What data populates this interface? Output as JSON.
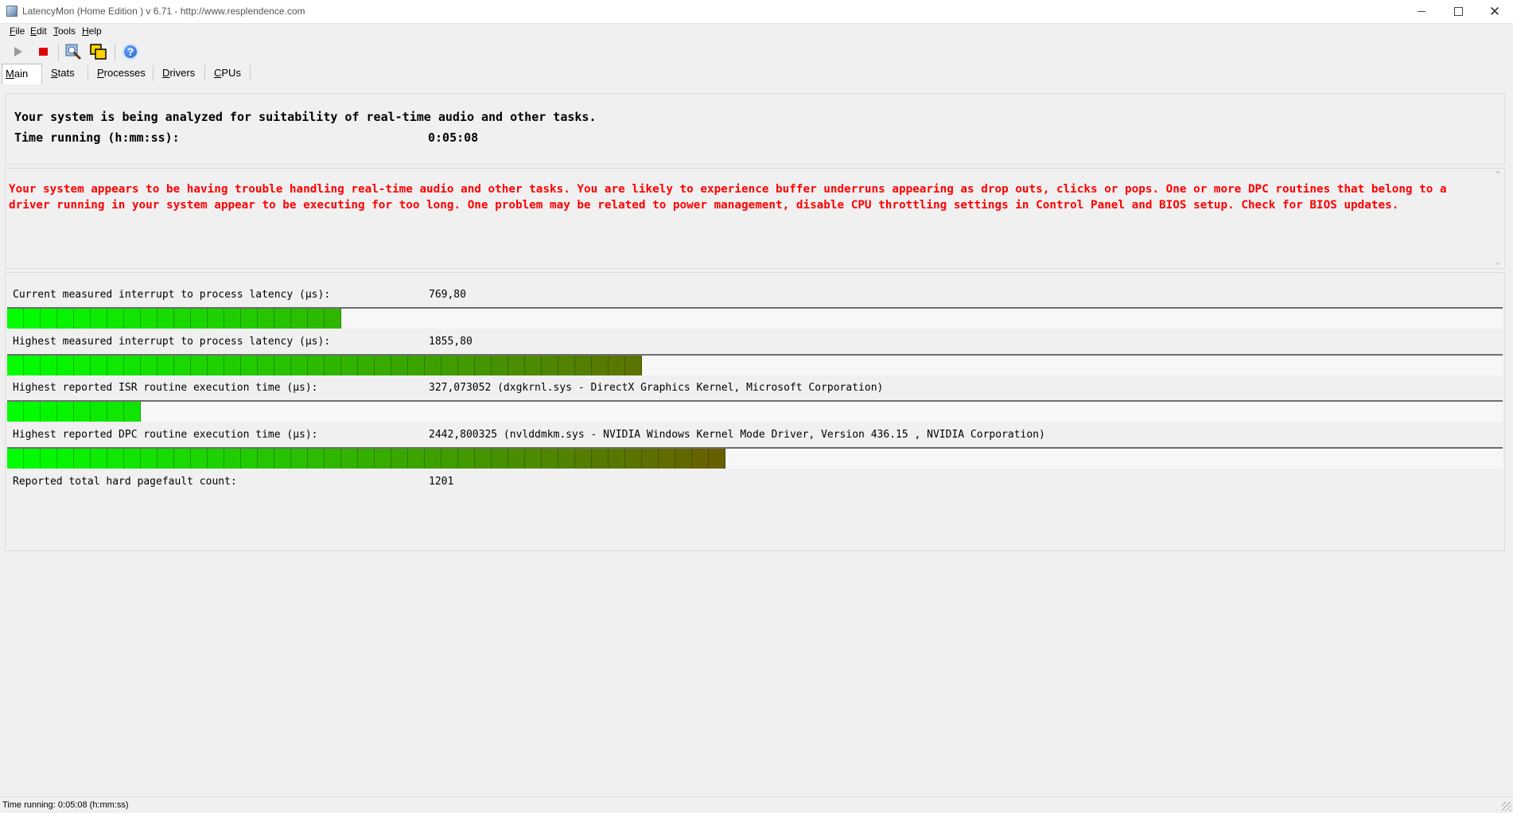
{
  "window": {
    "title": "LatencyMon  (Home Edition )  v 6.71 - http://www.resplendence.com",
    "minimize_glyph": "",
    "close_glyph": "✕"
  },
  "menu": [
    "File",
    "Edit",
    "Tools",
    "Help"
  ],
  "toolbar": {
    "icons": [
      "play-icon",
      "stop-icon",
      "system-info-icon",
      "windows-icon",
      "help-icon"
    ],
    "help_glyph": "?"
  },
  "tabs": [
    {
      "label": "Main",
      "active": true
    },
    {
      "label": "Stats",
      "active": false
    },
    {
      "label": "Processes",
      "active": false
    },
    {
      "label": "Drivers",
      "active": false
    },
    {
      "label": "CPUs",
      "active": false
    }
  ],
  "analysis": {
    "line1": "Your system is being analyzed for suitability of real-time audio and other tasks.",
    "time_label": "Time running (h:mm:ss):",
    "time_value": "0:05:08"
  },
  "warning": {
    "text": "Your system appears to be having trouble handling real-time audio and other tasks. You are likely to experience buffer underruns appearing as drop outs, clicks or pops. One or more DPC routines that belong to a driver running in your system appear to be executing for too long. One problem may be related to power management, disable CPU throttling settings in Control Panel and BIOS setup. Check for BIOS updates.",
    "scroll_up": "⌃",
    "scroll_down": "⌄"
  },
  "metrics": [
    {
      "label": "Current measured interrupt to process latency (µs):",
      "value": "769,80",
      "bar_segments": 20
    },
    {
      "label": "Highest measured interrupt to process latency (µs):",
      "value": "1855,80",
      "bar_segments": 38
    },
    {
      "label": "Highest reported ISR routine execution time (µs):",
      "value": "327,073052  (dxgkrnl.sys - DirectX Graphics Kernel, Microsoft Corporation)",
      "bar_segments": 8
    },
    {
      "label": "Highest reported DPC routine execution time (µs):",
      "value": "2442,800325  (nvlddmkm.sys - NVIDIA Windows Kernel Mode Driver, Version 436.15 , NVIDIA Corporation)",
      "bar_segments": 43
    },
    {
      "label": "Reported total hard pagefault count:",
      "value": "1201",
      "bar_segments": 0
    }
  ],
  "bar_colors": {
    "start": "#00ff00",
    "end": "#8a2a00"
  },
  "status": {
    "text": "Time running: 0:05:08  (h:mm:ss)"
  }
}
